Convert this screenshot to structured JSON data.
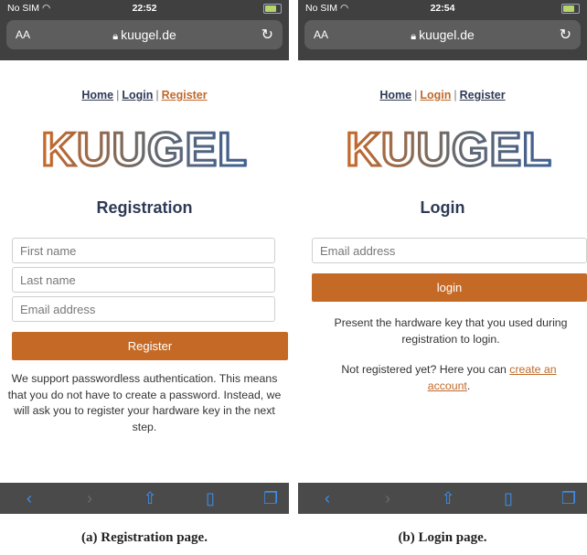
{
  "left": {
    "status": {
      "carrier": "No SIM",
      "time": "22:52"
    },
    "url": {
      "aa": "AA",
      "domain": "kuugel.de"
    },
    "nav": {
      "home": "Home",
      "login": "Login",
      "register": "Register",
      "sep": "|"
    },
    "logo": "KUUGEL",
    "heading": "Registration",
    "fields": {
      "first_name": "First name",
      "last_name": "Last name",
      "email": "Email address"
    },
    "button": "Register",
    "info": "We support passwordless authentication. This means that you do not have to create a password. Instead, we will ask you to register your hardware key in the next step."
  },
  "right": {
    "status": {
      "carrier": "No SIM",
      "time": "22:54"
    },
    "url": {
      "aa": "AA",
      "domain": "kuugel.de"
    },
    "nav": {
      "home": "Home",
      "login": "Login",
      "register": "Register",
      "sep": "|"
    },
    "logo": "KUUGEL",
    "heading": "Login",
    "fields": {
      "email": "Email address"
    },
    "button": "login",
    "info": "Present the hardware key that you used during registration to login.",
    "not_registered": "Not registered yet? Here you can",
    "create_link": "create an account",
    "period": "."
  },
  "captions": {
    "left": "(a) Registration page.",
    "right": "(b) Login page."
  },
  "colors": {
    "accent": "#c56a26",
    "chrome": "#404040",
    "heading": "#2e3a55",
    "toolbar_icon": "#3b8fef"
  },
  "icons": [
    "wifi-icon",
    "battery-icon",
    "lock-icon",
    "reload-icon",
    "back-icon",
    "forward-icon",
    "share-icon",
    "bookmarks-icon",
    "tabs-icon"
  ]
}
